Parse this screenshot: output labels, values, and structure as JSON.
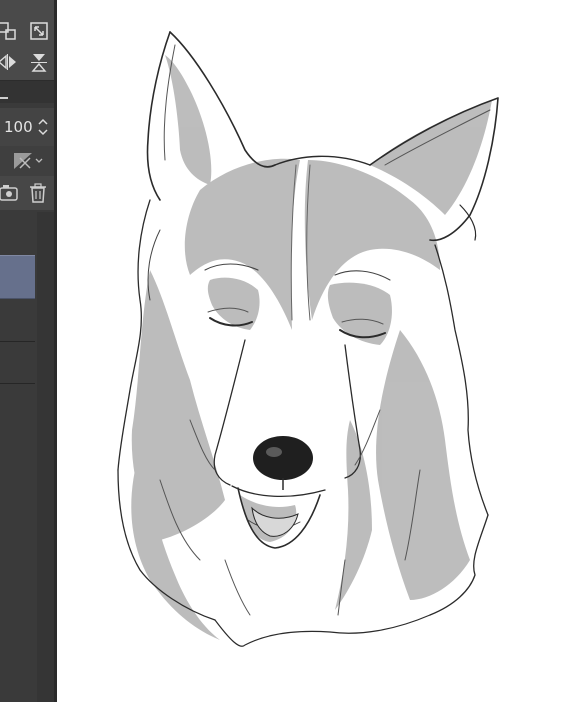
{
  "layer_panel": {
    "opacity_value": "100",
    "selected_layer_color": "#66708c",
    "icons": [
      "transform-icon",
      "fit-icon",
      "flip-horizontal-icon",
      "flip-vertical-icon",
      "spinner-icon",
      "mask-icon",
      "new-layer-icon",
      "delete-icon"
    ]
  },
  "canvas": {
    "artwork": "husky-sketch-drawing",
    "shade_color": "#b8b8b8",
    "line_color": "#2b2b2b"
  }
}
